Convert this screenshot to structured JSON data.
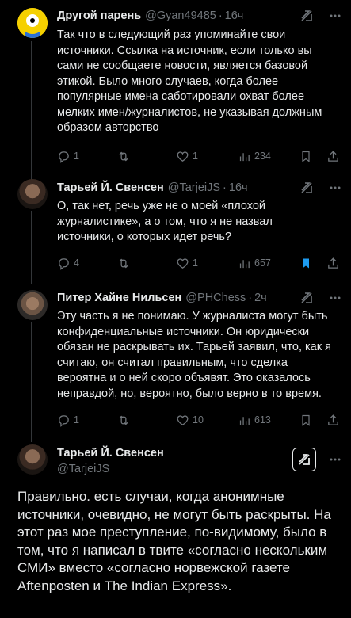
{
  "replies": [
    {
      "name": "Другой парень",
      "handle": "@Gyan49485",
      "time": "16ч",
      "text": "Так что в следующий раз упоминайте свои\nисточники. Ссылка на источник, если только вы\nсами не сообщаете новости, является базовой\nэтикой. Было много случаев, когда более\nпопулярные имена саботировали охват более\nмелких имен/журналистов, не указывая должным\nобразом авторство",
      "replies_count": "1",
      "retweets_count": "",
      "likes_count": "1",
      "views_count": "234"
    },
    {
      "name": "Тарьей Й. Свенсен",
      "handle": "@TarjeiJS",
      "time": "16ч",
      "text": "О, так нет, речь уже не о моей «плохой\nжурналистике», а о том, что я не назвал\nисточники, о которых идет речь?",
      "replies_count": "4",
      "retweets_count": "",
      "likes_count": "1",
      "views_count": "657"
    },
    {
      "name": "Питер Хайне Нильсен",
      "handle": "@PHChess",
      "time": "2ч",
      "text": "Эту часть я не понимаю. У журналиста могут быть\nконфиденциальные источники. Он юридически\nобязан не раскрывать их. Тарьей заявил, что, как я\nсчитаю, он считал правильным, что сделка\nвероятна и о ней скоро объявят. Это оказалось\nнеправдой, но, вероятно, было верно в то время.",
      "replies_count": "1",
      "retweets_count": "",
      "likes_count": "10",
      "views_count": "613"
    }
  ],
  "main": {
    "name": "Тарьей Й. Свенсен",
    "handle": "@TarjeiJS",
    "text": "Правильно. есть случаи, когда анонимные источники, очевидно, не могут быть раскрыты. На этот раз мое преступление, по-видимому, было в том, что я написал в твите «согласно нескольким СМИ» вместо «согласно норвежской газете Aftenposten и The Indian Express»."
  },
  "colors": {
    "background": "#000000",
    "text": "#e7e9ea",
    "muted": "#71767b",
    "bookmark_active": "#1d9bf0",
    "thread_line": "#333639"
  }
}
